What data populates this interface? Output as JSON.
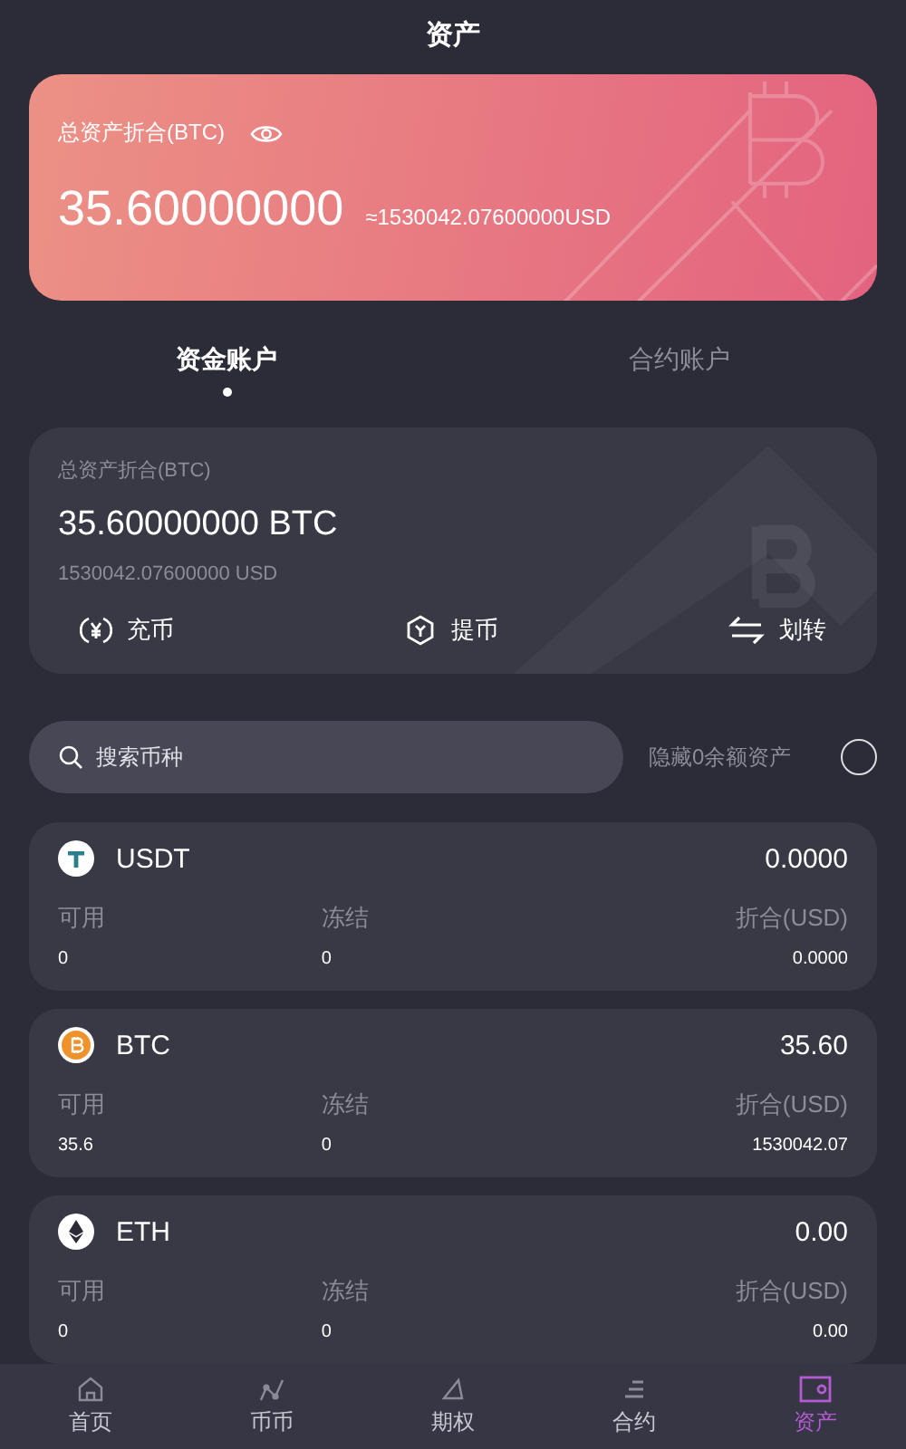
{
  "header": {
    "title": "资产"
  },
  "summary": {
    "label": "总资产折合(BTC)",
    "amount": "35.60000000",
    "usd": "≈1530042.07600000USD"
  },
  "tabs": [
    {
      "label": "资金账户",
      "selected": true
    },
    {
      "label": "合约账户",
      "selected": false
    }
  ],
  "account": {
    "label": "总资产折合(BTC)",
    "amount": "35.60000000 BTC",
    "usd": "1530042.07600000 USD",
    "actions": [
      {
        "kind": "deposit",
        "label": "充币"
      },
      {
        "kind": "withdraw",
        "label": "提币"
      },
      {
        "kind": "transfer",
        "label": "划转"
      }
    ]
  },
  "search": {
    "placeholder": "搜索币种"
  },
  "hide_zero": {
    "label": "隐藏0余额资产",
    "checked": false
  },
  "coins": [
    {
      "kind": "usdt",
      "symbol": "USDT",
      "total": "0.0000",
      "columns": [
        {
          "label": "可用",
          "value": "0"
        },
        {
          "label": "冻结",
          "value": "0"
        },
        {
          "label": "折合(USD)",
          "value": "0.0000"
        }
      ]
    },
    {
      "kind": "btc",
      "symbol": "BTC",
      "total": "35.60",
      "columns": [
        {
          "label": "可用",
          "value": "35.6"
        },
        {
          "label": "冻结",
          "value": "0"
        },
        {
          "label": "折合(USD)",
          "value": "1530042.07"
        }
      ]
    },
    {
      "kind": "eth",
      "symbol": "ETH",
      "total": "0.00",
      "columns": [
        {
          "label": "可用",
          "value": "0"
        },
        {
          "label": "冻结",
          "value": "0"
        },
        {
          "label": "折合(USD)",
          "value": "0.00"
        }
      ]
    }
  ],
  "nav": [
    {
      "kind": "home",
      "label": "首页",
      "selected": false
    },
    {
      "kind": "spot",
      "label": "币币",
      "selected": false
    },
    {
      "kind": "options",
      "label": "期权",
      "selected": false
    },
    {
      "kind": "contract",
      "label": "合约",
      "selected": false
    },
    {
      "kind": "assets",
      "label": "资产",
      "selected": true
    }
  ]
}
